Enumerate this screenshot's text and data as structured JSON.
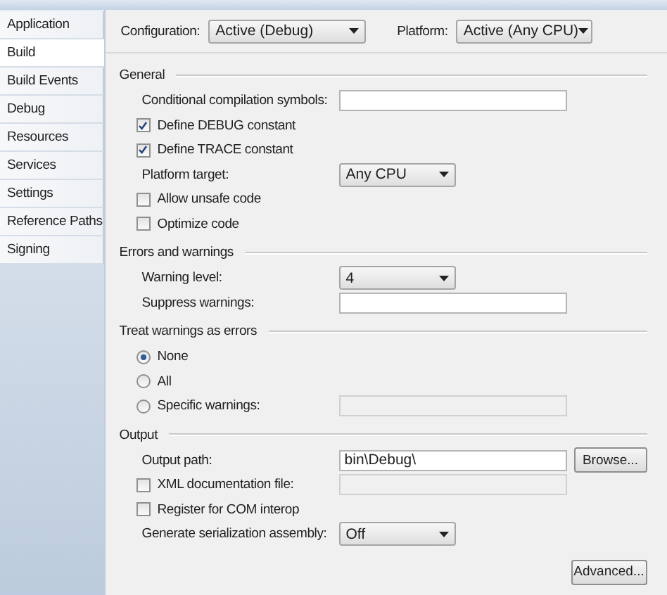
{
  "sidebar": {
    "tabs": [
      {
        "label": "Application",
        "selected": false
      },
      {
        "label": "Build",
        "selected": true
      },
      {
        "label": "Build Events",
        "selected": false
      },
      {
        "label": "Debug",
        "selected": false
      },
      {
        "label": "Resources",
        "selected": false
      },
      {
        "label": "Services",
        "selected": false
      },
      {
        "label": "Settings",
        "selected": false
      },
      {
        "label": "Reference Paths",
        "selected": false
      },
      {
        "label": "Signing",
        "selected": false
      }
    ]
  },
  "toolbar": {
    "configuration": {
      "label": "Configuration:",
      "value": "Active (Debug)"
    },
    "platform": {
      "label": "Platform:",
      "value": "Active (Any CPU)"
    }
  },
  "sections": [
    {
      "title": "General",
      "rows": [
        {
          "kind": "text",
          "label": "Conditional compilation symbols:",
          "disabled": false
        },
        {
          "kind": "checkbox",
          "label": "Define DEBUG constant",
          "checked": true
        },
        {
          "kind": "checkbox",
          "label": "Define TRACE constant",
          "checked": true
        },
        {
          "kind": "select",
          "label": "Platform target:",
          "value": "Any CPU"
        },
        {
          "kind": "checkbox",
          "label": "Allow unsafe code",
          "checked": false
        },
        {
          "kind": "checkbox",
          "label": "Optimize code",
          "checked": false
        }
      ]
    },
    {
      "title": "Errors and warnings",
      "rows": [
        {
          "kind": "select",
          "label": "Warning level:",
          "value": "4"
        },
        {
          "kind": "text",
          "label": "Suppress warnings:",
          "disabled": false
        }
      ]
    },
    {
      "title": "Treat warnings as errors",
      "rows": [
        {
          "kind": "radio",
          "label": "None",
          "selected": true
        },
        {
          "kind": "radio",
          "label": "All",
          "selected": false
        },
        {
          "kind": "radio",
          "label": "Specific warnings:",
          "selected": false,
          "field_disabled": true
        }
      ]
    },
    {
      "title": "Output",
      "rows": [
        {
          "kind": "text",
          "label": "Output path:",
          "value": "bin\\Debug\\",
          "disabled": false,
          "button": "Browse..."
        },
        {
          "kind": "checkbox",
          "label": "XML documentation file:",
          "checked": false,
          "field_disabled": true
        },
        {
          "kind": "checkbox",
          "label": "Register for COM interop",
          "checked": false
        },
        {
          "kind": "select",
          "label": "Generate serialization assembly:",
          "value": "Off"
        },
        {
          "kind": "button",
          "label": "Advanced..."
        }
      ]
    }
  ]
}
